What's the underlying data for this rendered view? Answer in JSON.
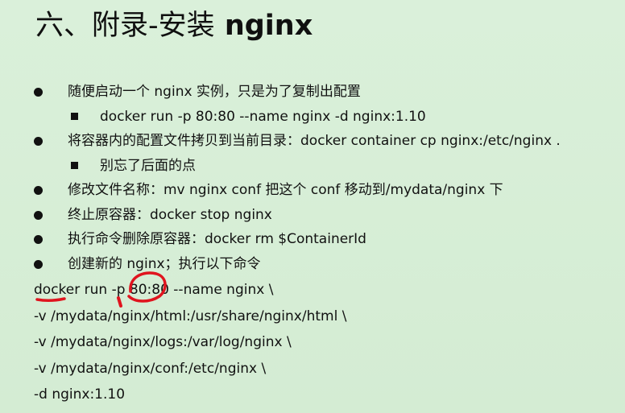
{
  "slide": {
    "title_cn": "六、附录-安装",
    "title_en": "nginx",
    "bullets": [
      {
        "level": 1,
        "text": "随便启动一个 nginx 实例，只是为了复制出配置"
      },
      {
        "level": 2,
        "text": "docker run -p 80:80 --name nginx    -d nginx:1.10"
      },
      {
        "level": 1,
        "text": "将容器内的配置文件拷贝到当前目录：docker container cp nginx:/etc/nginx ."
      },
      {
        "level": 2,
        "text": "别忘了后面的点"
      },
      {
        "level": 1,
        "text": "修改文件名称：mv nginx conf    把这个 conf 移动到/mydata/nginx 下"
      },
      {
        "level": 1,
        "text": "终止原容器：docker stop nginx"
      },
      {
        "level": 1,
        "text": "执行命令删除原容器：docker rm $ContainerId"
      },
      {
        "level": 1,
        "text": "创建新的 nginx；执行以下命令"
      }
    ],
    "command_lines": [
      "docker run -p 80:80 --name nginx \\",
      "-v /mydata/nginx/html:/usr/share/nginx/html \\",
      "-v /mydata/nginx/logs:/var/log/nginx \\",
      "-v /mydata/nginx/conf:/etc/nginx \\",
      "-d nginx:1.10"
    ]
  },
  "colors": {
    "background": "#d7eed7",
    "text": "#111111",
    "annotation": "#e0141e",
    "spellcheck": "#dd2222"
  }
}
